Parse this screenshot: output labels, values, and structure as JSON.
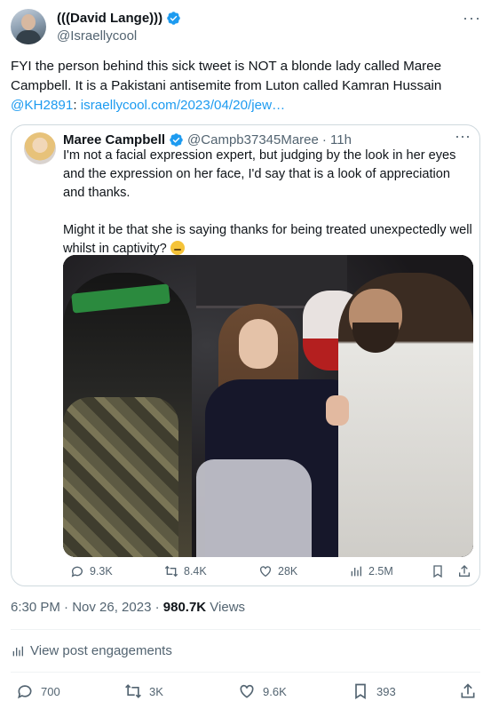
{
  "author": {
    "name": "(((David Lange)))",
    "handle": "@Israellycool"
  },
  "tweet": {
    "text_prefix": "FYI the person behind this sick tweet is NOT a blonde lady called Maree Campbell. It is a Pakistani antisemite from Luton called Kamran Hussain",
    "mention": "@KH2891",
    "colon": ":",
    "link": "israellycool.com/2023/04/20/jew…"
  },
  "quoted": {
    "name": "Maree Campbell",
    "handle": "@Campb37345Maree",
    "time": "· 11h",
    "paragraph1": "I'm not a facial expression expert, but judging by the look in her eyes and the expression on her face, I'd say that is a look of appreciation and thanks.",
    "paragraph2": "Might it be that she is saying thanks for being treated unexpectedly well whilst in captivity?",
    "stats": {
      "replies": "9.3K",
      "reposts": "8.4K",
      "likes": "28K",
      "views": "2.5M"
    }
  },
  "meta": {
    "time": "6:30 PM · Nov 26, 2023 · ",
    "views_count": "980.7K",
    "views_label": " Views"
  },
  "engagements_label": "View post engagements",
  "actions": {
    "replies": "700",
    "reposts": "3K",
    "likes": "9.6K",
    "bookmarks": "393"
  },
  "colors": {
    "accent": "#1d9bf0",
    "muted": "#536471",
    "text": "#0f1419",
    "border": "#cfd9de"
  },
  "icons": [
    "verified-badge-icon",
    "more-icon",
    "reply-icon",
    "repost-icon",
    "like-icon",
    "views-icon",
    "bookmark-icon",
    "share-icon",
    "thinking-emoji-icon"
  ]
}
